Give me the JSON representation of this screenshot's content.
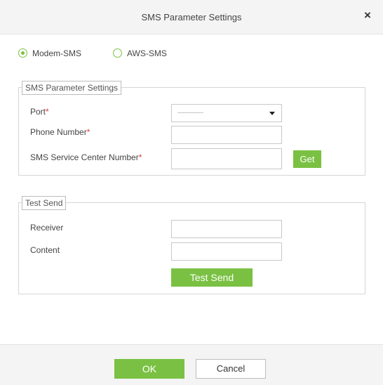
{
  "dialog": {
    "title": "SMS Parameter Settings",
    "close_glyph": "×"
  },
  "mode": {
    "options": [
      {
        "label": "Modem-SMS",
        "selected": true
      },
      {
        "label": "AWS-SMS",
        "selected": false
      }
    ]
  },
  "sms_settings": {
    "legend": "SMS Parameter Settings",
    "port_label": "Port",
    "port_value": "————",
    "phone_label": "Phone Number",
    "phone_value": "",
    "center_label": "SMS Service Center Number",
    "center_value": "",
    "required_mark": "*",
    "get_label": "Get"
  },
  "test_send": {
    "legend": "Test Send",
    "receiver_label": "Receiver",
    "receiver_value": "",
    "content_label": "Content",
    "content_value": "",
    "button_label": "Test Send"
  },
  "footer": {
    "ok_label": "OK",
    "cancel_label": "Cancel"
  },
  "colors": {
    "accent": "#7ac143",
    "required": "#e23a3a"
  },
  "icons": {
    "close": "close-icon",
    "dropdown": "chevron-down-icon"
  }
}
